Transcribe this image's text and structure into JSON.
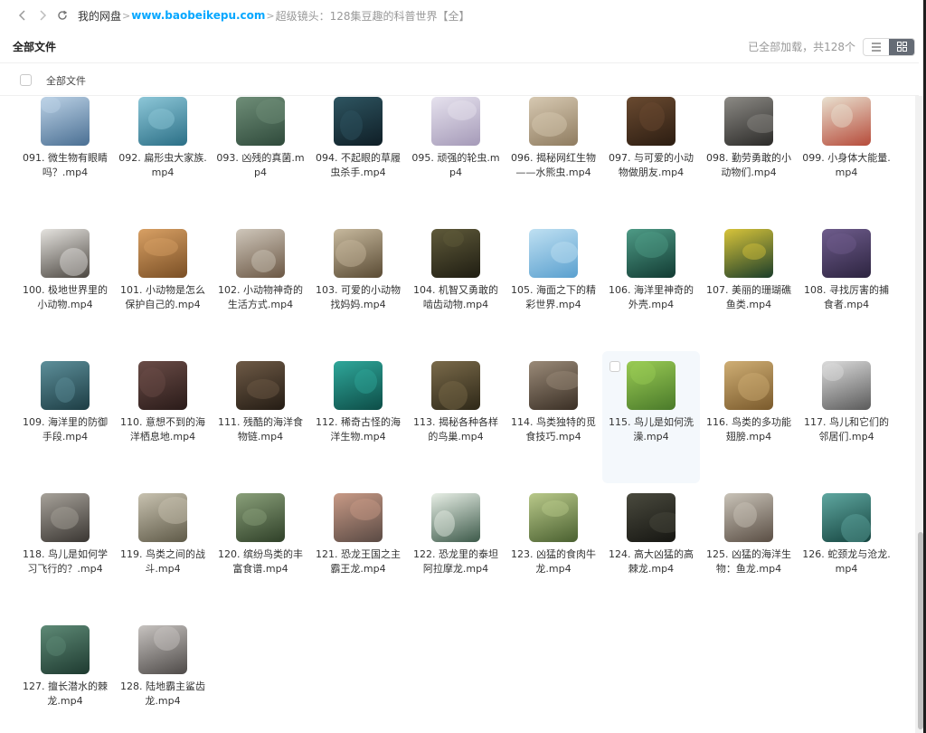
{
  "nav": {
    "root": "我的网盘",
    "site": "www.baobeikepu.com",
    "current": "超级镜头：128集豆趣的科普世界【全】",
    "sep": ">"
  },
  "toolbar": {
    "title": "全部文件",
    "status": "已全部加载，共128个",
    "list_view_icon": "list-icon",
    "grid_view_icon": "grid-icon"
  },
  "selection": {
    "label": "全部文件"
  },
  "files": [
    {
      "name": "091. 微生物有眼睛吗？.mp4",
      "colors": [
        "#bcd2e6",
        "#4a6f93"
      ]
    },
    {
      "name": "092. 扁形虫大家族.mp4",
      "colors": [
        "#8dc7d8",
        "#2b6f86"
      ]
    },
    {
      "name": "093. 凶残的真菌.mp4",
      "colors": [
        "#6f8e78",
        "#2f4a3b"
      ]
    },
    {
      "name": "094. 不起眼的草履虫杀手.mp4",
      "colors": [
        "#2e5561",
        "#0f1e26"
      ]
    },
    {
      "name": "095. 顽强的轮虫.mp4",
      "colors": [
        "#e6e2ee",
        "#a59ab8"
      ]
    },
    {
      "name": "096. 揭秘网红生物——水熊虫.mp4",
      "colors": [
        "#d7c9b2",
        "#8f7c60"
      ]
    },
    {
      "name": "097. 与可爱的小动物做朋友.mp4",
      "colors": [
        "#6a4a30",
        "#2c1d12"
      ]
    },
    {
      "name": "098. 勤劳勇敢的小动物们.mp4",
      "colors": [
        "#8c8a85",
        "#2b2a28"
      ]
    },
    {
      "name": "099. 小身体大能量.mp4",
      "colors": [
        "#e9e1d0",
        "#b64b3a"
      ]
    },
    {
      "name": "100. 极地世界里的小动物.mp4",
      "colors": [
        "#e5e3df",
        "#4b4640"
      ]
    },
    {
      "name": "101. 小动物是怎么保护自己的.mp4",
      "colors": [
        "#d8a064",
        "#7a4f25"
      ]
    },
    {
      "name": "102. 小动物神奇的生活方式.mp4",
      "colors": [
        "#cfc7bb",
        "#6b5744"
      ]
    },
    {
      "name": "103. 可爱的小动物找妈妈.mp4",
      "colors": [
        "#c7b99e",
        "#5a4b34"
      ]
    },
    {
      "name": "104. 机智又勇敢的啮齿动物.mp4",
      "colors": [
        "#5f5a3a",
        "#1f1d12"
      ]
    },
    {
      "name": "105. 海面之下的精彩世界.mp4",
      "colors": [
        "#bfe0f2",
        "#5aa0cf"
      ]
    },
    {
      "name": "106. 海洋里神奇的外壳.mp4",
      "colors": [
        "#4e9b86",
        "#123b33"
      ]
    },
    {
      "name": "107. 美丽的珊瑚礁鱼类.mp4",
      "colors": [
        "#d8c43a",
        "#1b3d2a"
      ]
    },
    {
      "name": "108. 寻找厉害的捕食者.mp4",
      "colors": [
        "#6e5c8c",
        "#2d2440"
      ]
    },
    {
      "name": "109. 海洋里的防御手段.mp4",
      "colors": [
        "#5d8f9a",
        "#1d3d44"
      ]
    },
    {
      "name": "110. 意想不到的海洋栖息地.mp4",
      "colors": [
        "#6a4c47",
        "#2a1b19"
      ]
    },
    {
      "name": "111. 残酷的海洋食物链.mp4",
      "colors": [
        "#6e5a46",
        "#241c14"
      ]
    },
    {
      "name": "112. 稀奇古怪的海洋生物.mp4",
      "colors": [
        "#2fa79a",
        "#0d4d47"
      ]
    },
    {
      "name": "113. 揭秘各种各样的鸟巢.mp4",
      "colors": [
        "#7a6a4a",
        "#2e2818"
      ]
    },
    {
      "name": "114. 鸟类独特的觅食技巧.mp4",
      "colors": [
        "#9a8a78",
        "#3a2f25"
      ]
    },
    {
      "name": "115. 鸟儿是如何洗澡.mp4",
      "colors": [
        "#9acb54",
        "#4a7a2a"
      ]
    },
    {
      "name": "116. 鸟类的多功能翅膀.mp4",
      "colors": [
        "#cfae74",
        "#7a5a2c"
      ]
    },
    {
      "name": "117. 鸟儿和它们的邻居们.mp4",
      "colors": [
        "#dcdcdc",
        "#5a5a5a"
      ]
    },
    {
      "name": "118. 鸟儿是如何学习飞行的？.mp4",
      "colors": [
        "#a7a29a",
        "#3a3632"
      ]
    },
    {
      "name": "119. 鸟类之间的战斗.mp4",
      "colors": [
        "#c8c2b0",
        "#5f5a48"
      ]
    },
    {
      "name": "120. 缤纷鸟类的丰富食谱.mp4",
      "colors": [
        "#8aa07a",
        "#2f4028"
      ]
    },
    {
      "name": "121. 恐龙王国之主 霸王龙.mp4",
      "colors": [
        "#c89a86",
        "#5a4a44"
      ]
    },
    {
      "name": "122. 恐龙里的泰坦 阿拉摩龙.mp4",
      "colors": [
        "#e8efe6",
        "#3d5a4a"
      ]
    },
    {
      "name": "123. 凶猛的食肉牛龙.mp4",
      "colors": [
        "#b9c98a",
        "#4a6030"
      ]
    },
    {
      "name": "124. 高大凶猛的高棘龙.mp4",
      "colors": [
        "#4a4a3e",
        "#161612"
      ]
    },
    {
      "name": "125. 凶猛的海洋生物：鱼龙.mp4",
      "colors": [
        "#c9c3b8",
        "#5a4e44"
      ]
    },
    {
      "name": "126. 蛇颈龙与沧龙.mp4",
      "colors": [
        "#5fa7a0",
        "#15443f"
      ]
    },
    {
      "name": "127. 擅长潜水的棘龙.mp4",
      "colors": [
        "#5e8a76",
        "#1e3a30"
      ]
    },
    {
      "name": "128. 陆地霸主鲨齿龙.mp4",
      "colors": [
        "#c7c3c0",
        "#4e4a48"
      ]
    }
  ],
  "hover_index": 24
}
